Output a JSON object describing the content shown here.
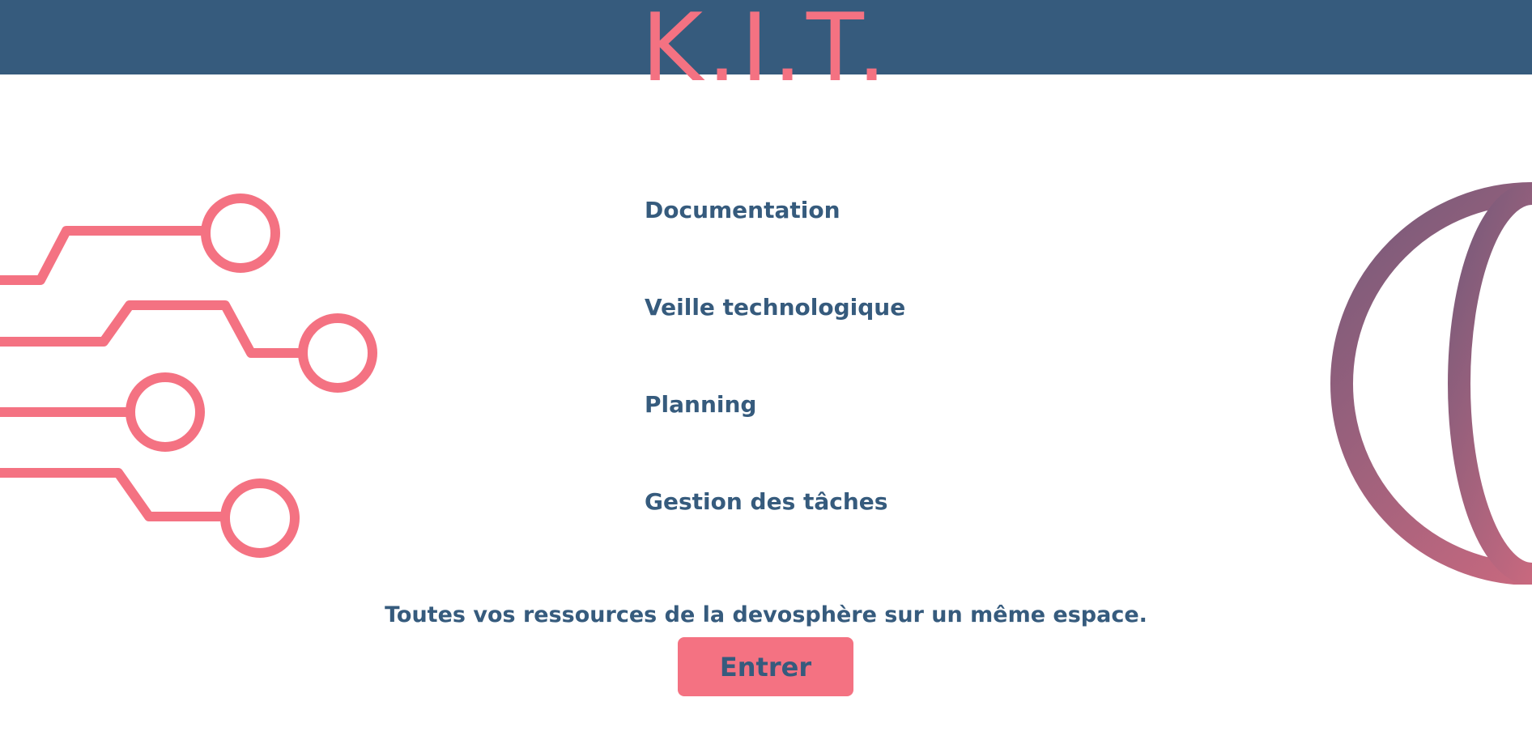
{
  "header": {
    "logo_text": "K.I.T."
  },
  "nav": {
    "items": [
      {
        "label": "Documentation"
      },
      {
        "label": "Veille technologique"
      },
      {
        "label": "Planning"
      },
      {
        "label": "Gestion des tâches"
      }
    ]
  },
  "hero": {
    "tagline": "Toutes vos ressources de la devosphère sur un même espace.",
    "enter_label": "Entrer"
  },
  "icons": {
    "circuit": "circuit-icon",
    "globe": "globe-icon"
  },
  "colors": {
    "header_bg": "#365b7d",
    "accent_pink": "#f47282",
    "text_blue": "#365b7d",
    "globe_gradient_start": "#7a5a7a",
    "globe_gradient_end": "#e06c80"
  }
}
